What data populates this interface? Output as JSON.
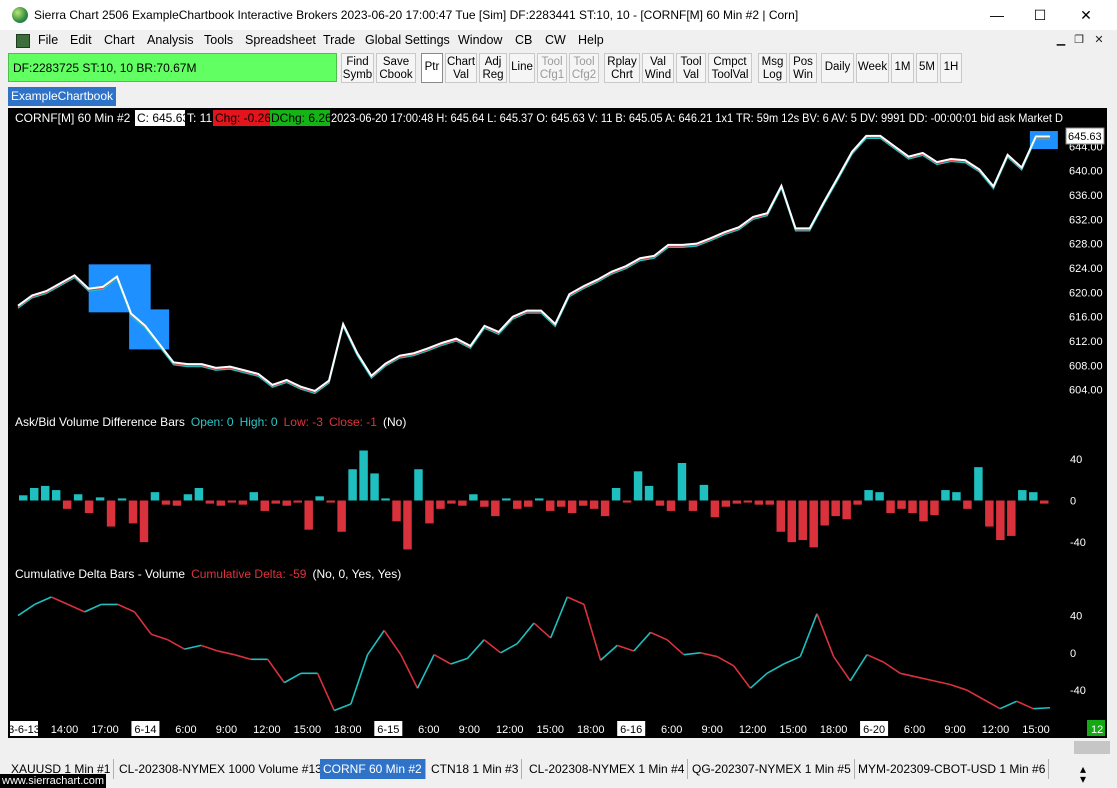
{
  "window": {
    "title": "Sierra Chart 2506 ExampleChartbook Interactive Brokers 2023-06-20  17:00:47 Tue [Sim]  DF:2283441  ST:10, 10 - [CORNF[M]  60 Min  #2 | Corn]",
    "minimize": "—",
    "maximize": "☐",
    "close": "✕"
  },
  "menu": [
    "File",
    "Edit",
    "Chart",
    "Analysis",
    "Tools",
    "Spreadsheet",
    "Trade",
    "Global Settings",
    "Window",
    "CB",
    "CW",
    "Help"
  ],
  "mdi": [
    "▁",
    "❐",
    "✕"
  ],
  "status": "DF:2283725  ST:10, 10  BR:70.67M",
  "toolbar": [
    {
      "label": "Find\nSymb"
    },
    {
      "label": "Save\nCbook"
    },
    {
      "label": "Ptr"
    },
    {
      "label": "Chart\nVal"
    },
    {
      "label": "Adj\nReg"
    },
    {
      "label": "Line"
    },
    {
      "label": "Tool\nCfg1"
    },
    {
      "label": "Tool\nCfg2"
    },
    {
      "label": "Rplay\nChrt"
    },
    {
      "label": "Val\nWind"
    },
    {
      "label": "Tool\nVal"
    },
    {
      "label": "Cmpct\nToolVal"
    },
    {
      "label": "Msg\nLog"
    },
    {
      "label": "Pos\nWin"
    },
    {
      "label": "Daily"
    },
    {
      "label": "Week"
    },
    {
      "label": "1M"
    },
    {
      "label": "5M"
    },
    {
      "label": "1H"
    }
  ],
  "chartbook_tab": "ExampleChartbook",
  "header": {
    "symbol": "CORNF[M]  60 Min  #2",
    "close": "C: 645.63",
    "trades": "T: 11",
    "chg": "Chg: -0.26",
    "dchg": "DChg: 6.26",
    "rest": "2023-06-20 17:00:48 H: 645.64 L: 645.37 O: 645.63 V: 11 B: 645.05 A: 646.21 1x1 TR: 59m 12s BV: 6 AV: 5 DV: 9991 DD: -00:00:01 bid ask  Market D"
  },
  "price_label": "645.63",
  "study1": {
    "name": "Ask/Bid Volume Difference Bars",
    "open": "Open: 0",
    "high": "High: 0",
    "low": "Low: -3",
    "close": "Close: -1",
    "params": "(No)"
  },
  "study2": {
    "name": "Cumulative Delta Bars - Volume",
    "value": "Cumulative Delta: -59",
    "params": "(No, 0, Yes, Yes)"
  },
  "corner_count": "12",
  "chart_tabs": [
    "XAUUSD  1 Min  #1",
    "CL-202308-NYMEX  1000 Volume #13",
    "CORNF  60 Min  #2",
    "CTN18  1 Min  #3",
    "CL-202308-NYMEX  1 Min  #4",
    "QG-202307-NYMEX  1 Min  #5",
    "MYM-202309-CBOT-USD  1 Min  #6"
  ],
  "website": "www.sierrachart.com",
  "colors": {
    "up": "#1fbfbf",
    "down": "#d9323c",
    "accent": "#2f73c9",
    "price_bg": "#1e90ff"
  },
  "chart_data": [
    {
      "type": "line",
      "name": "price",
      "y_ticks": [
        "644.00",
        "640.00",
        "636.00",
        "632.00",
        "628.00",
        "624.00",
        "620.00",
        "616.00",
        "612.00",
        "608.00",
        "604.00"
      ],
      "ylim": [
        601,
        647
      ],
      "values": [
        617.8,
        619.5,
        620.2,
        621.5,
        622.8,
        620.6,
        620.9,
        622.6,
        616.5,
        614.5,
        611.5,
        608.5,
        608.2,
        608.2,
        607.6,
        607.8,
        607.2,
        606.6,
        604.8,
        605.6,
        604.5,
        603.8,
        605.5,
        614.8,
        610.0,
        606.3,
        608.3,
        609.6,
        610.0,
        610.8,
        611.7,
        612.4,
        611.2,
        614.5,
        613.5,
        616.0,
        617.0,
        617.0,
        614.8,
        619.7,
        621.0,
        622.1,
        623.4,
        624.3,
        625.6,
        626.0,
        627.8,
        627.8,
        628.0,
        628.9,
        629.9,
        630.7,
        632.4,
        633.0,
        637.5,
        630.5,
        630.5,
        634.8,
        638.9,
        643.1,
        645.7,
        645.7,
        644.0,
        642.3,
        642.9,
        641.4,
        641.9,
        641.7,
        640.2,
        637.4,
        642.6,
        640.5,
        645.6,
        645.6
      ],
      "x_ticks": [
        "3-6-13",
        "14:00",
        "17:00",
        "6-14",
        "6:00",
        "9:00",
        "12:00",
        "15:00",
        "18:00",
        "6-15",
        "6:00",
        "9:00",
        "12:00",
        "15:00",
        "18:00",
        "6-16",
        "6:00",
        "9:00",
        "12:00",
        "15:00",
        "18:00",
        "6-20",
        "6:00",
        "9:00",
        "12:00",
        "15:00"
      ],
      "x_tick_highlight": [
        "3-6-13",
        "6-14",
        "6-15",
        "6-16",
        "6-20"
      ]
    },
    {
      "type": "bar",
      "name": "Ask/Bid Volume Difference Bars",
      "y_ticks": [
        "40",
        "0",
        "-40"
      ],
      "ylim": [
        -60,
        60
      ],
      "values": [
        5,
        12,
        14,
        10,
        -8,
        6,
        -12,
        3,
        -25,
        2,
        -22,
        -40,
        8,
        -4,
        -5,
        6,
        12,
        -3,
        -5,
        -2,
        -4,
        8,
        -10,
        -3,
        -5,
        -2,
        -28,
        4,
        -2,
        -30,
        30,
        48,
        26,
        2,
        -20,
        -47,
        30,
        -22,
        -8,
        -3,
        -5,
        6,
        -6,
        -15,
        2,
        -8,
        -6,
        2,
        -10,
        -6,
        -12,
        -5,
        -8,
        -15,
        12,
        -2,
        28,
        14,
        -5,
        -10,
        36,
        -10,
        15,
        -16,
        -6,
        -3,
        -2,
        -4,
        -4,
        -30,
        -40,
        -38,
        -45,
        -24,
        -15,
        -18,
        -4,
        10,
        8,
        -12,
        -8,
        -12,
        -20,
        -14,
        10,
        8,
        -8,
        32,
        -25,
        -38,
        -34,
        10,
        8,
        -3
      ]
    },
    {
      "type": "line",
      "name": "Cumulative Delta Bars - Volume",
      "y_ticks": [
        "40",
        "0",
        "-40"
      ],
      "ylim": [
        -70,
        75
      ],
      "values": [
        40,
        52,
        60,
        52,
        44,
        52,
        52,
        44,
        20,
        14,
        4,
        8,
        2,
        -2,
        -7,
        -7,
        -32,
        -22,
        -22,
        -62,
        -55,
        -2,
        24,
        -2,
        -38,
        -2,
        -12,
        -6,
        14,
        0,
        10,
        32,
        16,
        60,
        52,
        -8,
        8,
        2,
        22,
        14,
        -2,
        0,
        -4,
        -14,
        -38,
        -22,
        -12,
        -4,
        42,
        -4,
        -30,
        -2,
        -10,
        -22,
        -26,
        -30,
        -34,
        -40,
        -50,
        -60,
        -52,
        -60,
        -59
      ]
    }
  ]
}
